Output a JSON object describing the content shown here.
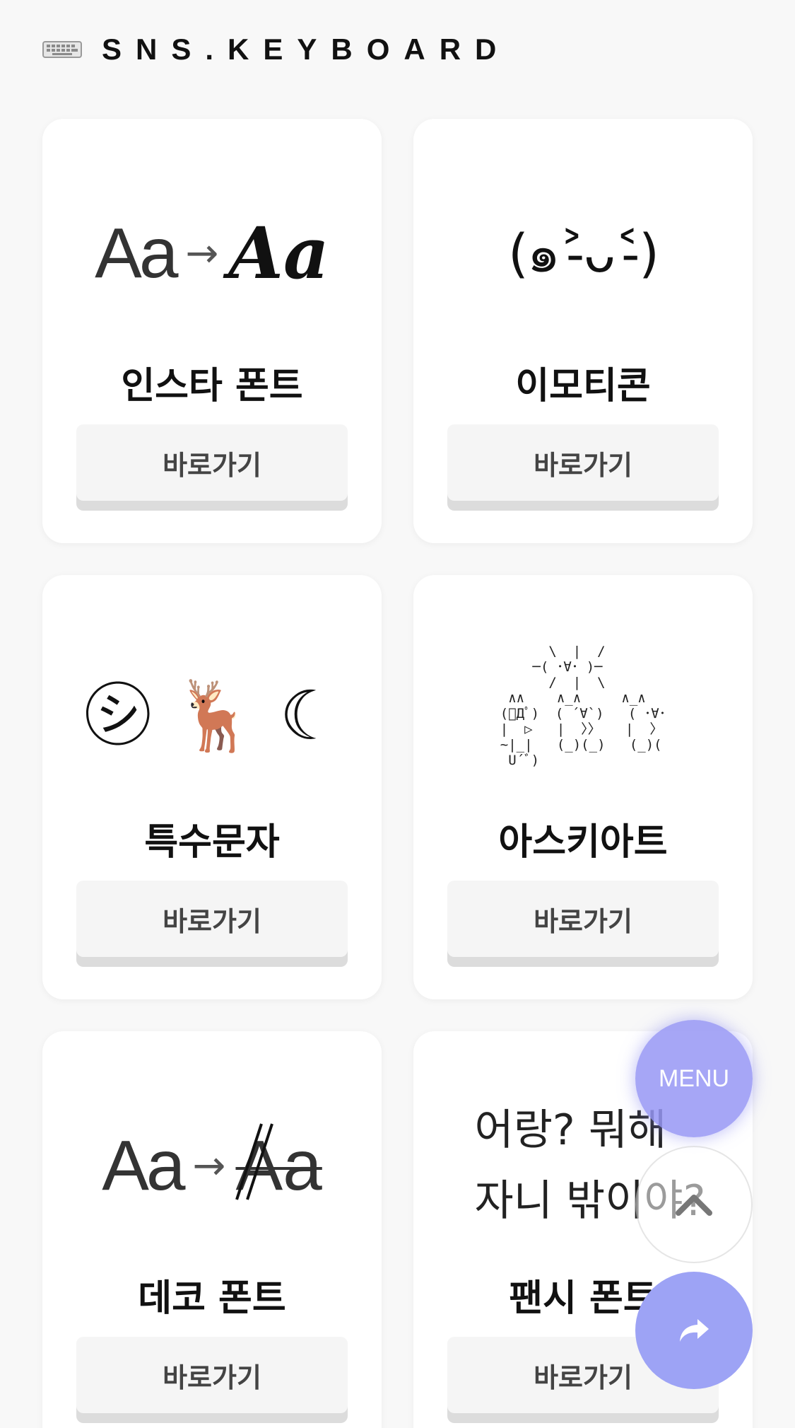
{
  "header": {
    "icon": "keyboard-icon",
    "brand": "SNS.KEYBOARD"
  },
  "cards": [
    {
      "title": "인스타 폰트",
      "button_label": "바로가기",
      "image": {
        "icon": "font-transform-illustration",
        "text_left": "Aa",
        "arrow": "→",
        "text_right": "Aa"
      }
    },
    {
      "title": "이모티콘",
      "button_label": "바로가기",
      "image": {
        "icon": "emoticon-illustration",
        "text": "(๑˃̵ᴗ˂̵)"
      }
    },
    {
      "title": "특수문자",
      "button_label": "바로가기",
      "image": {
        "icon": "special-characters-illustration",
        "text": "㋛ 🦌 ☾"
      }
    },
    {
      "title": "아스키아트",
      "button_label": "바로가기",
      "image": {
        "icon": "ascii-art-illustration",
        "text": "      \\  |  /\n    ─( ･∀･ )─\n      /  |  \\\n ∧∧    ∧_∧     ∧_∧\n(ﾟДﾟ)  ( ´∀`)   ( ･∀･\n|  ▷   |  〉〉   |  〉\n~|_|   (_)(_)   (_)(\n U´ﾞ)"
      }
    },
    {
      "title": "데코 폰트",
      "button_label": "바로가기",
      "image": {
        "icon": "deco-font-illustration",
        "text_left": "Aa",
        "arrow": "→",
        "text_right": "Aa"
      }
    },
    {
      "title": "팬시 폰트",
      "button_label": "바로가기",
      "image": {
        "icon": "fancy-font-illustration",
        "line1": "어랑? 뭐해",
        "line2": "자니 밖이야?"
      }
    }
  ],
  "fabs": {
    "menu_label": "MENU",
    "top_icon": "chevron-up-icon",
    "share_icon": "share-arrow-icon"
  },
  "colors": {
    "background": "#f8f8f8",
    "card": "#ffffff",
    "button": "#f5f5f5",
    "fab_accent": "#9da3f5"
  }
}
